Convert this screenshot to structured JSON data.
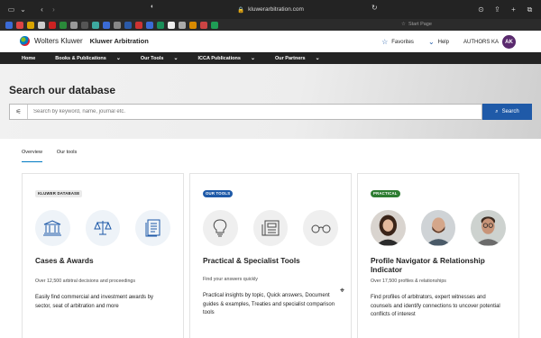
{
  "browser": {
    "url": "kluwerarbitration.com",
    "start_page": "Start Page"
  },
  "header": {
    "brand": "Wolters Kluwer",
    "product": "Kluwer Arbitration",
    "favorites": "Favorites",
    "help": "Help",
    "authors": "AUTHORS KA",
    "avatar_initials": "AK"
  },
  "nav": {
    "items": [
      {
        "label": "Home",
        "has_menu": false
      },
      {
        "label": "Books & Publications",
        "has_menu": true
      },
      {
        "label": "Our Tools",
        "has_menu": true
      },
      {
        "label": "ICCA Publications",
        "has_menu": true
      },
      {
        "label": "Our Partners",
        "has_menu": true
      }
    ]
  },
  "hero": {
    "title": "Search our database",
    "search_placeholder": "Search by keyword, name, journal etc.",
    "search_button": "Search"
  },
  "tabs": [
    {
      "label": "Overview",
      "active": true
    },
    {
      "label": "Our tools",
      "active": false
    }
  ],
  "cards": [
    {
      "badge": "KLUWER DATABASE",
      "title": "Cases & Awards",
      "subtitle": "Over 12,500 arbitral decisions and proceedings",
      "description": "Easily find commercial and investment awards by sector, seat of arbitration and more",
      "icons": [
        "courthouse-icon",
        "scales-icon",
        "document-icon"
      ]
    },
    {
      "badge": "OUR TOOLS",
      "title": "Practical & Specialist Tools",
      "subtitle": "Find your answers quickly",
      "description": "Practical insights by topic, Quick answers, Document guides & examples, Treaties and specialist comparison tools",
      "icons": [
        "lightbulb-icon",
        "newspaper-icon",
        "glasses-icon"
      ]
    },
    {
      "badge": "PRACTICAL",
      "title": "Profile Navigator & Relationship Indicator",
      "subtitle": "Over 17,500 profiles & relationships",
      "description": "Find profiles of arbitrators, expert witnesses and counsels and identify connections to uncover potential conflicts of interest",
      "icons": [
        "profile-photo-woman",
        "profile-photo-man-beard",
        "profile-photo-man-glasses"
      ]
    }
  ],
  "colors": {
    "primary_blue": "#1f5aa8",
    "nav_bg": "#232323",
    "practical_green": "#2e7d32",
    "avatar_purple": "#5a2a6e"
  }
}
